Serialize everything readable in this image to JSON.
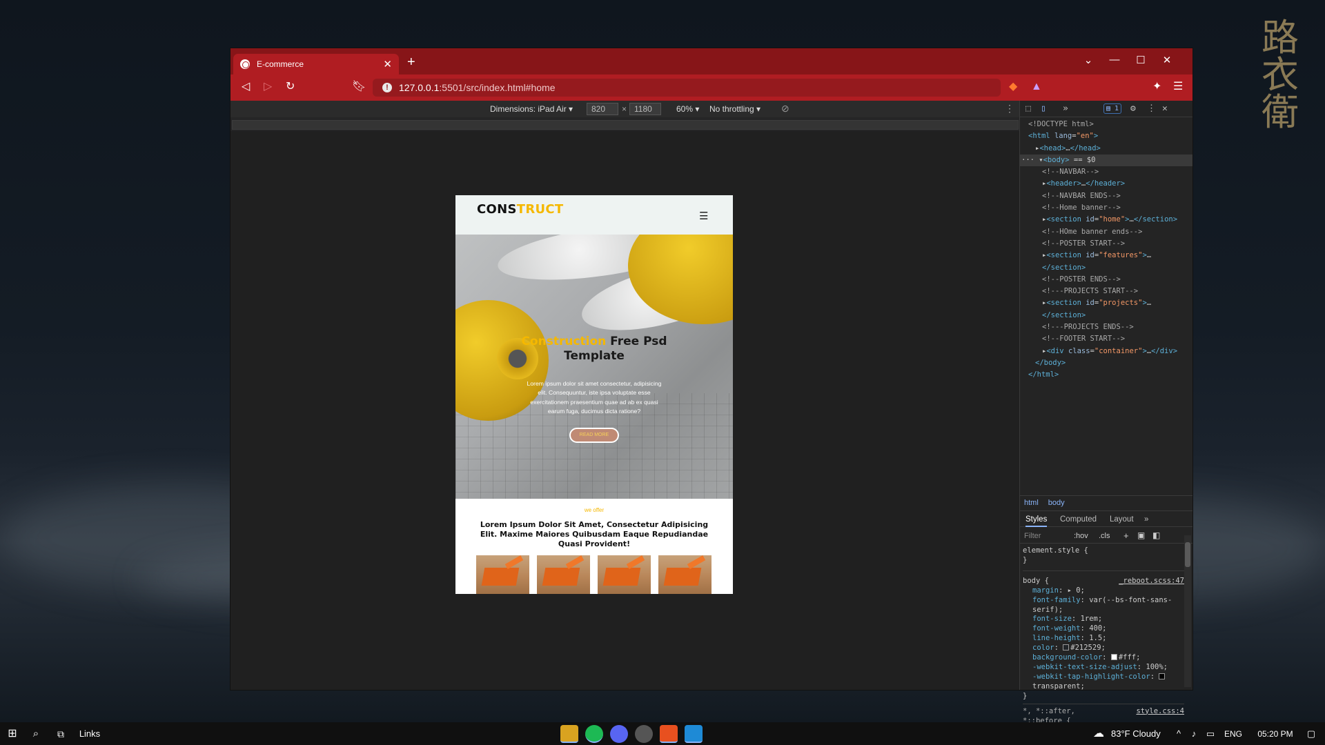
{
  "browser": {
    "tab_title": "E-commerce",
    "new_tab_label": "+",
    "url_host": "127.0.0.1",
    "url_rest": ":5501/src/index.html#home"
  },
  "device_toolbar": {
    "dimensions_label": "Dimensions: iPad Air",
    "width": "820",
    "times": "×",
    "height": "1180",
    "zoom": "60%",
    "throttling": "No throttling"
  },
  "site": {
    "brand_part1": "CONS",
    "brand_part2": "TRUCT",
    "hero_title_highlight": "Construction",
    "hero_title_rest": " Free Psd",
    "hero_title_line2": "Template",
    "hero_text": "Lorem ipsum dolor sit amet consectetur, adipisicing elit. Consequuntur, iste ipsa voluptate esse exercitationem praesentium quae ad ab ex quasi earum fuga, ducimus dicta ratione?",
    "hero_button": "READ MORE",
    "offer_small": "we offer",
    "offer_title": "Lorem Ipsum Dolor Sit Amet, Consectetur Adipisicing Elit. Maxime Maiores Quibusdam Eaque Repudiandae Quasi Provident!"
  },
  "devtools": {
    "issues_count": "1",
    "dom_lines": [
      {
        "indent": 0,
        "html": "<span class='cmt'>&lt;!DOCTYPE html&gt;</span>"
      },
      {
        "indent": 0,
        "html": "<span class='tag'>&lt;html</span> <span class='attr'>lang</span>=<span class='val'>\"en\"</span><span class='tag'>&gt;</span>"
      },
      {
        "indent": 1,
        "html": "▸<span class='tag'>&lt;head&gt;</span>…<span class='tag'>&lt;/head&gt;</span>"
      },
      {
        "indent": 0,
        "sel": true,
        "html": "··· ▾<span class='tag'>&lt;body&gt;</span> == $0"
      },
      {
        "indent": 2,
        "html": "<span class='cmt'>&lt;!--NAVBAR--&gt;</span>"
      },
      {
        "indent": 2,
        "html": "▸<span class='tag'>&lt;header&gt;</span>…<span class='tag'>&lt;/header&gt;</span>"
      },
      {
        "indent": 2,
        "html": "<span class='cmt'>&lt;!--NAVBAR ENDS--&gt;</span>"
      },
      {
        "indent": 2,
        "html": "<span class='cmt'>&lt;!--Home banner--&gt;</span>"
      },
      {
        "indent": 2,
        "html": "▸<span class='tag'>&lt;section</span> <span class='attr'>id</span>=<span class='val'>\"home\"</span><span class='tag'>&gt;</span>…<span class='tag'>&lt;/section&gt;</span>"
      },
      {
        "indent": 2,
        "html": "<span class='cmt'>&lt;!--HOme banner ends--&gt;</span>"
      },
      {
        "indent": 2,
        "html": "<span class='cmt'>&lt;!--POSTER START--&gt;</span>"
      },
      {
        "indent": 2,
        "html": "▸<span class='tag'>&lt;section</span> <span class='attr'>id</span>=<span class='val'>\"features\"</span><span class='tag'>&gt;</span>…"
      },
      {
        "indent": 2,
        "html": "<span class='tag'>&lt;/section&gt;</span>"
      },
      {
        "indent": 2,
        "html": "<span class='cmt'>&lt;!--POSTER ENDS--&gt;</span>"
      },
      {
        "indent": 2,
        "html": "<span class='cmt'>&lt;!---PROJECTS START--&gt;</span>"
      },
      {
        "indent": 2,
        "html": "▸<span class='tag'>&lt;section</span> <span class='attr'>id</span>=<span class='val'>\"projects\"</span><span class='tag'>&gt;</span>…"
      },
      {
        "indent": 2,
        "html": "<span class='tag'>&lt;/section&gt;</span>"
      },
      {
        "indent": 2,
        "html": "<span class='cmt'>&lt;!---PROJECTS ENDS--&gt;</span>"
      },
      {
        "indent": 2,
        "html": "<span class='cmt'>&lt;!--FOOTER START--&gt;</span>"
      },
      {
        "indent": 2,
        "html": "▸<span class='tag'>&lt;div</span> <span class='attr'>class</span>=<span class='val'>\"container\"</span><span class='tag'>&gt;</span>…<span class='tag'>&lt;/div&gt;</span>"
      },
      {
        "indent": 1,
        "html": "<span class='tag'>&lt;/body&gt;</span>"
      },
      {
        "indent": 0,
        "html": "<span class='tag'>&lt;/html&gt;</span>"
      }
    ],
    "breadcrumbs": [
      "html",
      "body"
    ],
    "styles_tabs": [
      "Styles",
      "Computed",
      "Layout",
      "»"
    ],
    "filter_placeholder": "Filter",
    "filter_hov": ":hov",
    "filter_cls": ".cls",
    "element_style": "element.style {",
    "close_brace": "}",
    "body_selector": "body {",
    "body_source": "_reboot.scss:47",
    "body_props": [
      {
        "name": "margin",
        "value": "▸ 0;"
      },
      {
        "name": "font-family",
        "value": "var(--bs-font-sans-serif);"
      },
      {
        "name": "font-size",
        "value": "1rem;"
      },
      {
        "name": "font-weight",
        "value": "400;"
      },
      {
        "name": "line-height",
        "value": "1.5;"
      },
      {
        "name": "color",
        "value": "#212529;",
        "swatch": "#212529"
      },
      {
        "name": "background-color",
        "value": "#fff;",
        "swatch": "#ffffff"
      },
      {
        "name": "-webkit-text-size-adjust",
        "value": "100%;"
      },
      {
        "name": "-webkit-tap-highlight-color",
        "value": "transparent;",
        "swatch": "#000000"
      }
    ],
    "after_selector": "*, *::after,",
    "after_selector2": "*::before {",
    "after_source": "style.css:4"
  },
  "taskbar": {
    "links_label": "Links",
    "weather_temp": "83°F",
    "weather_text": "Cloudy",
    "lang": "ENG",
    "time": "05:20 PM"
  },
  "icons": [
    "windows-icon",
    "search-icon",
    "task-view-icon",
    "file-explorer-icon",
    "spotify-icon",
    "discord-icon",
    "chrome-icon",
    "brave-icon",
    "vscode-icon"
  ],
  "colors": {
    "brave_red": "#b01d22",
    "accent_yellow": "#f5b800",
    "devtools_bg": "#242424"
  }
}
